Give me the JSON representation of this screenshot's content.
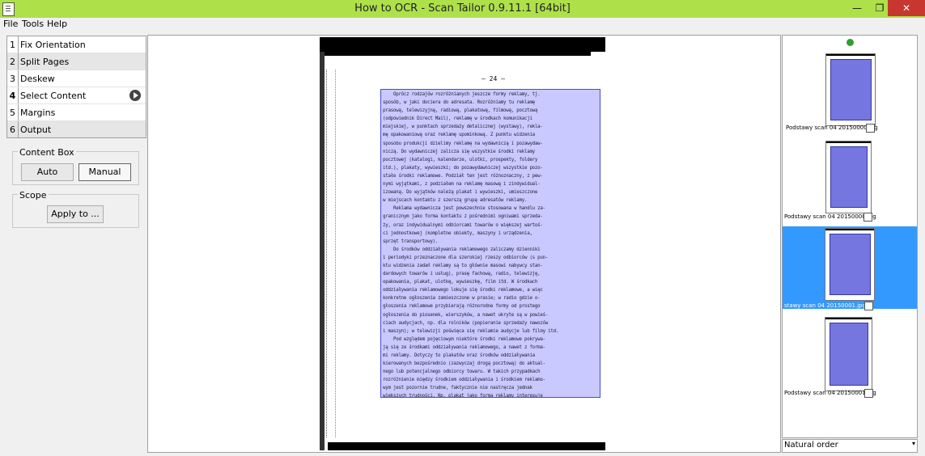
{
  "window": {
    "title": "How to OCR - Scan Tailor 0.9.11.1 [64bit]",
    "minimize": "—",
    "maximize": "❐",
    "close": "✕"
  },
  "menu": [
    "File",
    "Tools",
    "Help"
  ],
  "steps": [
    {
      "num": "1",
      "label": "Fix Orientation"
    },
    {
      "num": "2",
      "label": "Split Pages"
    },
    {
      "num": "3",
      "label": "Deskew"
    },
    {
      "num": "4",
      "label": "Select Content"
    },
    {
      "num": "5",
      "label": "Margins"
    },
    {
      "num": "6",
      "label": "Output"
    }
  ],
  "current_step": "4",
  "content_box": {
    "title": "Content Box",
    "auto": "Auto",
    "manual": "Manual",
    "selected": "Manual"
  },
  "scope": {
    "title": "Scope",
    "apply": "Apply to ..."
  },
  "page": {
    "number": "– 24 –",
    "lines": [
      "    Oprócz rodzajów rozróżnianych jeszcze formy reklamy, tj.",
      "sposób, w jaki dociera do adresata. Rozróżniamy tu reklamę",
      "prasową, telewizyjną, radiową, plakatową, filmową, pocztową",
      "(odpowiednik Direct Mail), reklamę w środkach komunikacji",
      "miejskiej, w punktach sprzedaży detalicznej (wystawy), rekla-",
      "mę opakowaniową oraz reklamę upominkową. Z punktu widzenia",
      "sposobu produkcji dzielimy reklamę na wydawniczą i pozawydaw-",
      "niczą. Do wydawniczej zalicza się wszystkie środki reklamy",
      "pocztowej (katalogi, kalendarze, ulotki, prospekty, foldery",
      "itd.), plakaty, wywieszki; do pozawydawniczej wszystkie pozo-",
      "stałe środki reklamowe. Podział ten jest różnoznaczny, z pew-",
      "nymi wyjątkami, z podziałem na reklamę masową i zindywidual-",
      "izowaną. Do wyjątków należą plakat i wywieszki, umieszczone",
      "w miejscach kontaktu z szerszą grupą adresatów reklamy.",
      "    Reklama wydawnicza jest powszechnie stosowana w handlu za-",
      "granicznym jako forma kontaktu z pośrednimi ogniwami sprzeda-",
      "ży, oraz indywidualnymi odbiorcami towarów o większej wartoś-",
      "ci jednostkowej (kompletne obiekty, maszyny i urządzenia,",
      "sprzęt transportowy).",
      "    Do środków oddziaływania reklamowego zaliczamy dzienniki",
      "i periodyki przeznaczone dla szerokiej rzeszy odbiorców (s pun-",
      "ktu widzenia zadań reklamy są to głównie masowi nabywcy stan-",
      "dardowych towarów i usług), prasę fachową, radio, telewizję,",
      "opakowania, plakat, ulotkę, wywieszkę, film itd. W środkach",
      "oddziaływania reklamowego lokuje się środki reklamowe, a więc",
      "konkretne ogłoszenia zamieszczone w prasie; w radio gdzie o-",
      "głoszenia reklamowe przybierają różnorodne formy od prostego",
      "ogłoszenia do piosenek, wierszyków, a nawet ukryte są w powieś-",
      "ciach audycjach, np. dla rolników (popieranie sprzedaży nawozów",
      "i maszyn); w telewizji poświęca się reklamie audycje lub filmy itd.",
      "    Pod względem pojęciowym niektóre środki reklamowe pokrywa-",
      "ją się ze środkami oddziaływania reklamowego, a nawet z forma-",
      "mi reklamy. Dotyczy to plakatów oraz środków oddziaływania",
      "kierowanych bezpośrednio (zazwyczaj drogą pocztową) do aktual-",
      "nego lub potencjalnego odbiorcy towaru. W takich przypadkach",
      "rozróżnienie między środkiem oddziaływania i środkiem reklamo-",
      "wym jest pozornie trudne, faktycznie nie nastręcza jednak",
      "większych trudności. Np. plakat jako forma reklamy interesuje"
    ]
  },
  "thumbnails": [
    {
      "caption": "Podstawy scan 04 20150000.jpg",
      "selected": false
    },
    {
      "caption": "Podstawy scan 04 20150000.jpg",
      "selected": false
    },
    {
      "caption": "stawy scan 04 20150001.jpg",
      "selected": true
    },
    {
      "caption": "Podstawy scan 04 20150001.jpg",
      "selected": false
    }
  ],
  "sort": {
    "value": "Natural order"
  },
  "colors": {
    "titlebar": "#aee04a",
    "selection": "#3399ff",
    "content_box": "#7878ff",
    "close": "#c7372f"
  }
}
